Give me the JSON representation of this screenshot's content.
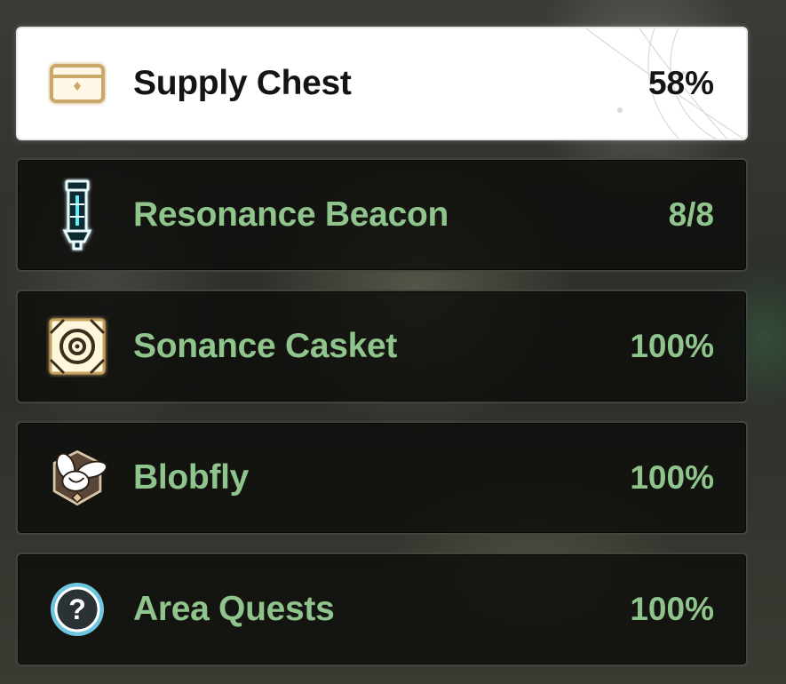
{
  "rows": [
    {
      "id": "supply-chest",
      "label": "Supply Chest",
      "value": "58%",
      "icon": "supply-chest-icon",
      "selected": true
    },
    {
      "id": "resonance-beacon",
      "label": "Resonance Beacon",
      "value": "8/8",
      "icon": "resonance-beacon-icon",
      "selected": false
    },
    {
      "id": "sonance-casket",
      "label": "Sonance Casket",
      "value": "100%",
      "icon": "sonance-casket-icon",
      "selected": false
    },
    {
      "id": "blobfly",
      "label": "Blobfly",
      "value": "100%",
      "icon": "blobfly-icon",
      "selected": false
    },
    {
      "id": "area-quests",
      "label": "Area Quests",
      "value": "100%",
      "icon": "area-quests-icon",
      "selected": false
    }
  ],
  "colors": {
    "label_green": "#8fc58d",
    "selected_text": "#141414",
    "selected_bg": "#ffffff",
    "row_bg": "#0c0c0a"
  }
}
